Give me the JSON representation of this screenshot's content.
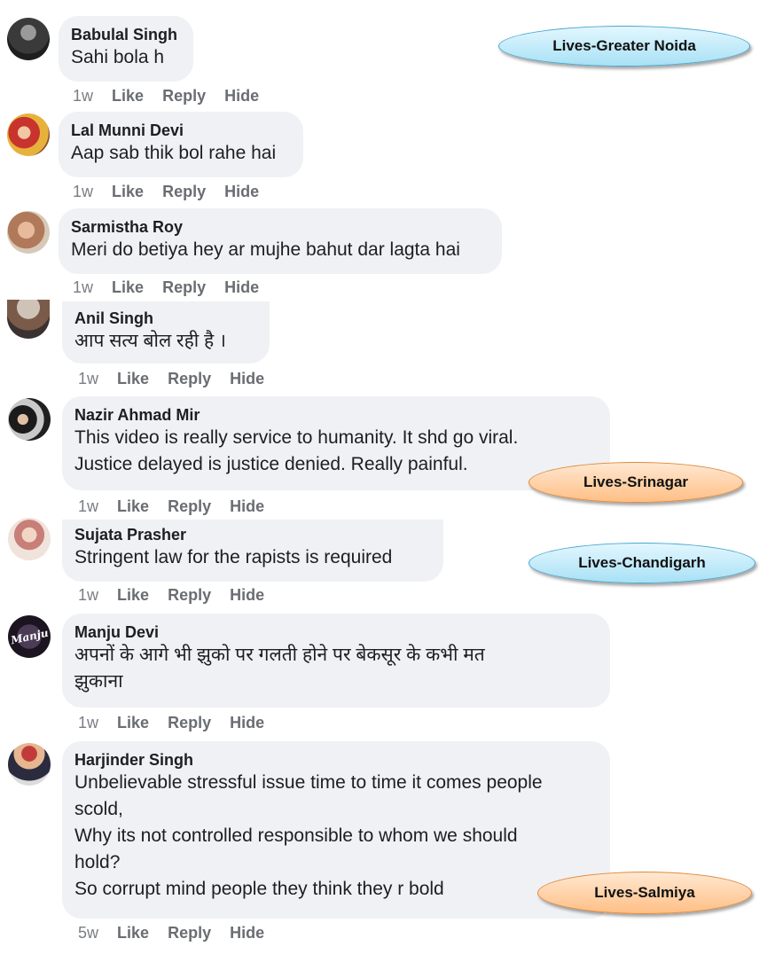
{
  "comments": [
    {
      "name": "Babulal Singh",
      "text": [
        "Sahi bola h"
      ],
      "time": "1w",
      "like": "Like",
      "reply": "Reply",
      "hide": "Hide"
    },
    {
      "name": "Lal Munni Devi",
      "text": [
        "Aap sab thik bol rahe hai"
      ],
      "time": "1w",
      "like": "Like",
      "reply": "Reply",
      "hide": "Hide"
    },
    {
      "name": "Sarmistha Roy",
      "text": [
        "Meri do betiya hey ar mujhe bahut dar lagta hai"
      ],
      "time": "1w",
      "like": "Like",
      "reply": "Reply",
      "hide": "Hide"
    },
    {
      "name": "Anil Singh",
      "text": [
        "आप सत्य बोल रही है ।"
      ],
      "time": "1w",
      "like": "Like",
      "reply": "Reply",
      "hide": "Hide"
    },
    {
      "name": "Nazir Ahmad Mir",
      "text": [
        "This video is really service to humanity. It shd go viral.",
        "Justice delayed is justice denied. Really painful."
      ],
      "time": "1w",
      "like": "Like",
      "reply": "Reply",
      "hide": "Hide"
    },
    {
      "name": "Sujata Prasher",
      "text": [
        "Stringent law for the rapists is required"
      ],
      "time": "1w",
      "like": "Like",
      "reply": "Reply",
      "hide": "Hide"
    },
    {
      "name": "Manju Devi",
      "text": [
        "अपनों के आगे भी झुको पर गलती होने पर बेकसूर के कभी मत",
        "झुकाना"
      ],
      "time": "1w",
      "like": "Like",
      "reply": "Reply",
      "hide": "Hide"
    },
    {
      "name": "Harjinder Singh",
      "text": [
        "Unbelievable stressful issue time to time it comes people",
        "scold,",
        "Why its not controlled responsible to whom we should",
        "hold?",
        "So corrupt mind people they think they r bold"
      ],
      "time": "5w",
      "like": "Like",
      "reply": "Reply",
      "hide": "Hide"
    }
  ],
  "tags": [
    {
      "label": "Lives-Greater Noida",
      "color": "#bfe9f9"
    },
    {
      "label": "Lives-Srinagar",
      "color": "#ffd2a8"
    },
    {
      "label": "Lives-Chandigarh",
      "color": "#bfe9f9"
    },
    {
      "label": "Lives-Salmiya",
      "color": "#ffd2a8"
    }
  ],
  "avatar_texts": {
    "manju": "Manju"
  }
}
